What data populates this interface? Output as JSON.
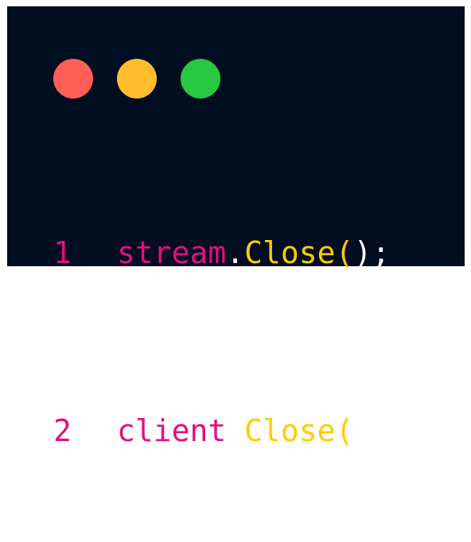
{
  "window": {
    "background": "#010d20",
    "controls": [
      {
        "name": "close",
        "color": "#ff5f57"
      },
      {
        "name": "minimize",
        "color": "#ffbd2e"
      },
      {
        "name": "maximize",
        "color": "#28c840"
      }
    ]
  },
  "code": {
    "colors": {
      "line_number": "#e0117d",
      "identifier": "#e0117d",
      "punctuation": "#ffffff",
      "method": "#ffcc00"
    },
    "lines": [
      {
        "number": "1",
        "object": "stream",
        "dot": ".",
        "method": "Close",
        "open_paren": "(",
        "close_paren": ")",
        "semicolon": ";"
      },
      {
        "number": "2",
        "object": "client",
        "dot": ".",
        "method": "Close",
        "open_paren": "(",
        "close_paren": ")",
        "semicolon": ";"
      }
    ]
  }
}
